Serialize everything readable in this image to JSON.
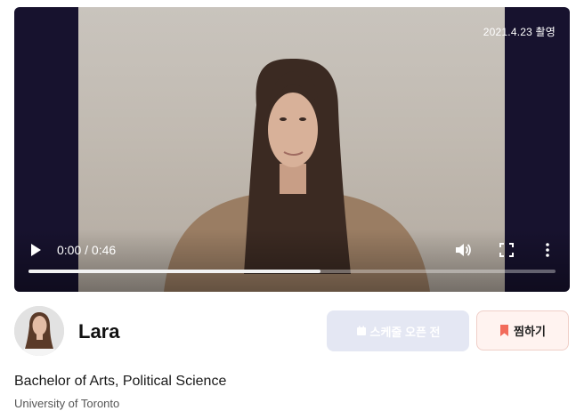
{
  "video": {
    "date_stamp": "2021.4.23 촬영",
    "current_time": "0:00",
    "duration": "0:46",
    "time_display": "0:00 / 0:46",
    "progress_fraction": 0.554,
    "icons": {
      "play": "play-icon",
      "volume": "volume-icon",
      "fullscreen": "fullscreen-icon",
      "more": "more-vertical-icon"
    }
  },
  "profile": {
    "name": "Lara",
    "degree": "Bachelor of Arts, Political Science",
    "school": "University of Toronto"
  },
  "actions": {
    "schedule_label": "스케줄 오픈 전",
    "schedule_icon": "calendar-icon",
    "favorite_label": "찜하기",
    "favorite_icon": "bookmark-icon"
  },
  "colors": {
    "accent": "#f26b5b",
    "disabled_button": "#e4e7f3",
    "video_background": "#17122e"
  }
}
